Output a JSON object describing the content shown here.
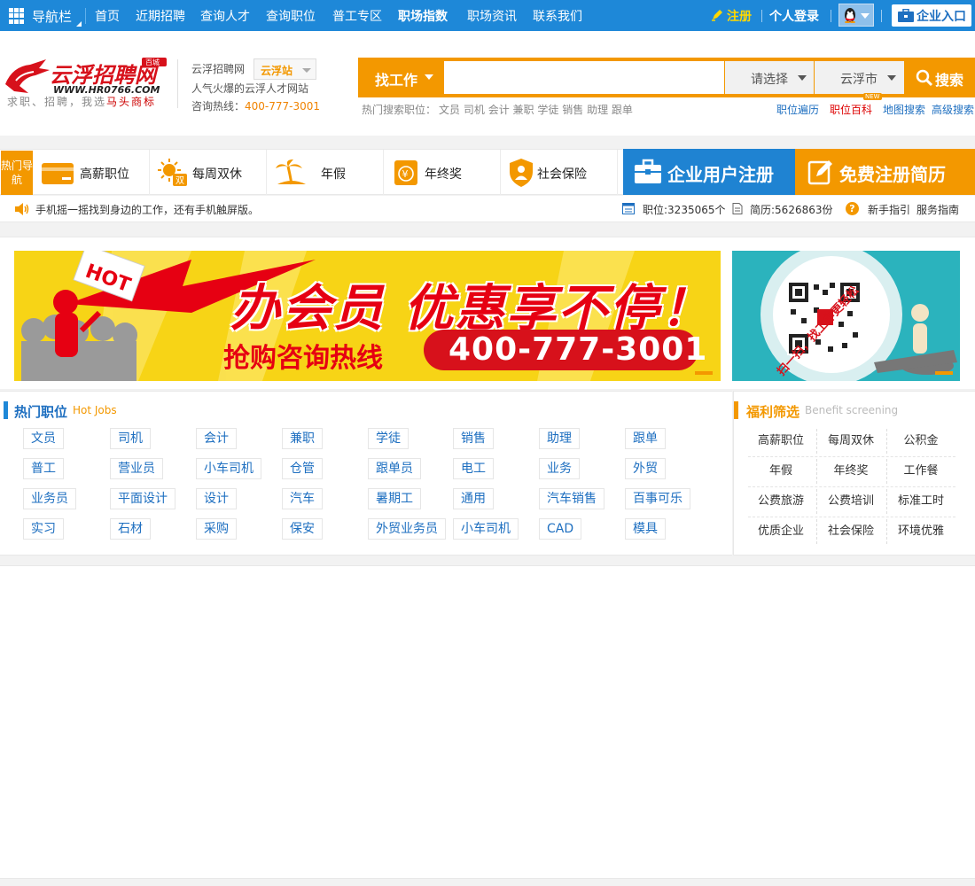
{
  "topbar": {
    "nav_label": "导航栏",
    "links": [
      "首页",
      "近期招聘",
      "查询人才",
      "查询职位",
      "普工专区",
      "职场指数",
      "职场资讯",
      "联系我们"
    ],
    "register": "注册",
    "login": "个人登录",
    "enterprise": "企业入口"
  },
  "header": {
    "logo_text": "云浮招聘网",
    "logo_url": "WWW.HR0766.COM",
    "logo_badge": "百城",
    "logo_tagline_prefix": "求职、招聘，我选",
    "logo_tagline_brand": "马头商标",
    "site_name": "云浮招聘网",
    "station": "云浮站",
    "slogan": "人气火爆的云浮人才网站",
    "hotline_label": "咨询热线：",
    "hotline": "400-777-3001"
  },
  "search": {
    "type": "找工作",
    "keyword": "",
    "category": "请选择",
    "city": "云浮市",
    "button": "搜索",
    "hot_label": "热门搜索职位：",
    "hot_terms": [
      "文员",
      "司机",
      "会计",
      "兼职",
      "学徒",
      "销售",
      "助理",
      "跟单"
    ],
    "quick_links": [
      "职位遍历",
      "职位百科",
      "地图搜索",
      "高级搜索"
    ],
    "new_badge": "NEW"
  },
  "benefits": {
    "nav_tag": "热门导航",
    "items": [
      "高薪职位",
      "每周双休",
      "年假",
      "年终奖",
      "社会保险"
    ],
    "reg_enterprise": "企业用户注册",
    "reg_resume": "免费注册简历"
  },
  "info": {
    "tip": "手机摇一摇找到身边的工作，还有手机触屏版。",
    "jobs_count": "职位:3235065个",
    "resume_count": "简历:5626863份",
    "links": [
      "新手指引",
      "服务指南"
    ]
  },
  "banners": {
    "main_headline": "办会员 优惠享不停！",
    "main_sub": "抢购咨询热线",
    "main_phone": "400-777-3001",
    "main_hot": "HOT",
    "side_text": "扫一扫，找工作更轻松"
  },
  "hot_jobs": {
    "title": "热门职位",
    "subtitle": "Hot Jobs",
    "rows": [
      [
        "文员",
        "司机",
        "会计",
        "兼职",
        "学徒",
        "销售",
        "助理",
        "跟单"
      ],
      [
        "普工",
        "营业员",
        "小车司机",
        "仓管",
        "跟单员",
        "电工",
        "业务",
        "外贸"
      ],
      [
        "业务员",
        "平面设计",
        "设计",
        "汽车",
        "暑期工",
        "通用",
        "汽车销售",
        "百事可乐"
      ],
      [
        "实习",
        "石材",
        "采购",
        "保安",
        "外贸业务员",
        "小车司机",
        "CAD",
        "模具"
      ]
    ]
  },
  "welfare": {
    "title": "福利筛选",
    "subtitle": "Benefit screening",
    "items": [
      [
        "高薪职位",
        "每周双休",
        "公积金"
      ],
      [
        "年假",
        "年终奖",
        "工作餐"
      ],
      [
        "公费旅游",
        "公费培训",
        "标准工时"
      ],
      [
        "优质企业",
        "社会保险",
        "环境优雅"
      ]
    ]
  },
  "colors": {
    "blue": "#1e88d8",
    "orange": "#f39800",
    "red": "#e60012"
  }
}
